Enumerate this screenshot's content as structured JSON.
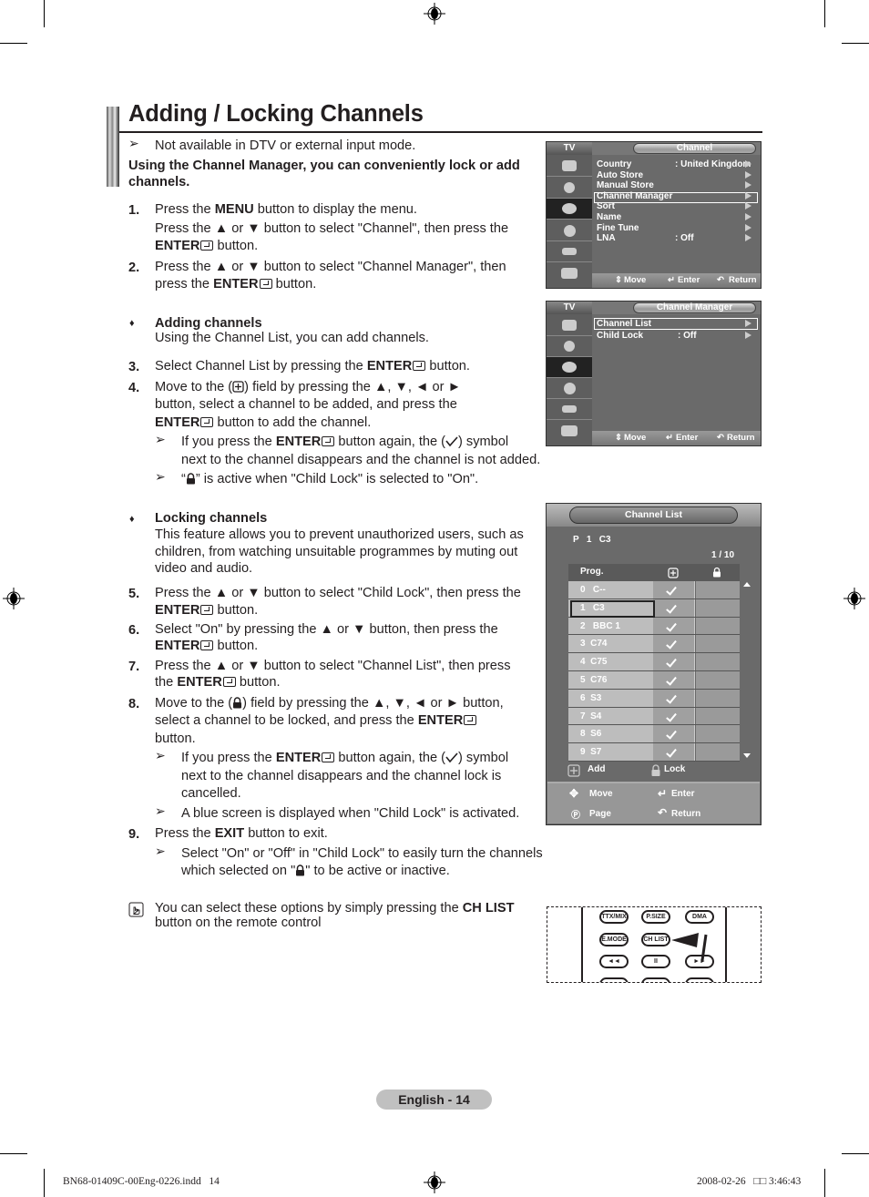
{
  "page": {
    "title": "Adding / Locking Channels",
    "note_top": "Not available in DTV or external input mode.",
    "intro": "Using the Channel Manager, you can conveniently lock or add",
    "intro2": "channels.",
    "steps": {
      "s1": {
        "num": "1.",
        "a": "Press the ",
        "b": "MENU",
        "c": " button to display the menu.",
        "line2": "Press the ▲ or ▼ button to select \"Channel\", then press the",
        "line3_b": "ENTER",
        "line3_c": " button."
      },
      "s2": {
        "num": "2.",
        "line1": "Press the ▲ or ▼ button to select \"Channel Manager\", then",
        "line2_a": "press the ",
        "line2_b": "ENTER",
        "line2_c": " button."
      },
      "adding": {
        "heading": "Adding channels",
        "desc": "Using the Channel List, you can add channels."
      },
      "s3": {
        "num": "3.",
        "a": "Select Channel List by pressing the ",
        "b": "ENTER",
        "c": " button."
      },
      "s4": {
        "num": "4.",
        "line1_a": "Move to the (",
        "line1_b": ") field by pressing the ▲, ▼, ◄ or ►",
        "line2": "button, select a channel to be added, and press the",
        "line3_b": "ENTER",
        "line3_c": " button to add the channel.",
        "note1_a": "If you press the ",
        "note1_b": "ENTER",
        "note1_c": " button again, the (",
        "note1_d": ") symbol",
        "note1_line2": "next to the channel disappears and the channel is not added.",
        "note2_a": "“",
        "note2_b": "” is active when \"Child Lock\" is selected to \"On\"."
      },
      "locking": {
        "heading": "Locking channels",
        "l1": "This feature allows you to prevent unauthorized users, such as",
        "l2": "children, from watching unsuitable programmes by muting out",
        "l3": "video and audio."
      },
      "s5": {
        "num": "5.",
        "line1": "Press the ▲ or ▼ button to select \"Child Lock\", then press the",
        "line2_b": "ENTER",
        "line2_c": " button."
      },
      "s6": {
        "num": "6.",
        "line1": "Select \"On\" by pressing the ▲ or ▼ button, then press the",
        "line2_b": "ENTER",
        "line2_c": " button."
      },
      "s7": {
        "num": "7.",
        "line1": "Press the ▲ or ▼ button to select \"Channel List\", then press",
        "line2_a": "the ",
        "line2_b": "ENTER",
        "line2_c": " button."
      },
      "s8": {
        "num": "8.",
        "line1_a": "Move to the (",
        "line1_b": ") field by pressing the ▲, ▼, ◄ or ► button,",
        "line2_a": "select a channel to be locked, and press the ",
        "line2_b": "ENTER",
        "line3": "button.",
        "note1_a": "If you press the ",
        "note1_b": "ENTER",
        "note1_c": " button again, the (",
        "note1_d": ") symbol",
        "note1_line2": "next to the channel disappears and the channel lock is",
        "note1_line3": "cancelled.",
        "note2": "A blue screen is displayed when \"Child Lock\" is activated."
      },
      "s9": {
        "num": "9.",
        "a": "Press the ",
        "b": "EXIT",
        "c": " button to exit.",
        "note_line1": "Select \"On\" or \"Off\" in \"Child Lock\" to easily turn the channels",
        "note_line2_a": "which selected on \"",
        "note_line2_b": "\" to be active or inactive."
      }
    },
    "tip": {
      "a": "You can select these options by simply pressing the ",
      "b": "CH LIST",
      "line2": "button on the remote control"
    },
    "page_label": "English - 14",
    "footer_left": "BN68-01409C-00Eng-0226.indd   14",
    "footer_right": "2008-02-26   □□ 3:46:43"
  },
  "osd_channel": {
    "tv_label": "TV",
    "title": "Channel",
    "items": [
      {
        "label": "Country",
        "value": ": United Kingdom"
      },
      {
        "label": "Auto Store",
        "value": ""
      },
      {
        "label": "Manual Store",
        "value": ""
      },
      {
        "label": "Channel Manager",
        "value": "",
        "selected": true
      },
      {
        "label": "Sort",
        "value": ""
      },
      {
        "label": "Name",
        "value": ""
      },
      {
        "label": "Fine Tune",
        "value": ""
      },
      {
        "label": "LNA",
        "value": ": Off"
      }
    ],
    "footer": {
      "move": "Move",
      "enter": "Enter",
      "return": "Return"
    }
  },
  "osd_manager": {
    "tv_label": "TV",
    "title": "Channel Manager",
    "items": [
      {
        "label": "Channel List",
        "value": "",
        "selected": true
      },
      {
        "label": "Child Lock",
        "value": ": Off"
      }
    ],
    "footer": {
      "move": "Move",
      "enter": "Enter",
      "return": "Return"
    }
  },
  "channel_list": {
    "title": "Channel List",
    "current": "P   1   C3",
    "page": "1 / 10",
    "col_prog": "Prog.",
    "rows": [
      {
        "prog": "0   C--",
        "added": true,
        "locked": false
      },
      {
        "prog": "1   C3",
        "added": true,
        "locked": false,
        "selected": true
      },
      {
        "prog": "2   BBC 1",
        "added": true,
        "locked": false
      },
      {
        "prog": "3  C74",
        "added": true,
        "locked": false
      },
      {
        "prog": "4  C75",
        "added": true,
        "locked": false
      },
      {
        "prog": "5  C76",
        "added": true,
        "locked": false
      },
      {
        "prog": "6  S3",
        "added": true,
        "locked": false
      },
      {
        "prog": "7  S4",
        "added": true,
        "locked": false
      },
      {
        "prog": "8  S6",
        "added": true,
        "locked": false
      },
      {
        "prog": "9  S7",
        "added": true,
        "locked": false
      }
    ],
    "legend": {
      "add": "Add",
      "lock": "Lock"
    },
    "footer": {
      "move": "Move",
      "enter": "Enter",
      "page": "Page",
      "return": "Return"
    }
  },
  "remote": {
    "buttons": [
      "TTX/MIX",
      "P.SIZE",
      "DMA",
      "E.MODE",
      "CH LIST",
      "◄◄",
      "II",
      "►►"
    ]
  }
}
